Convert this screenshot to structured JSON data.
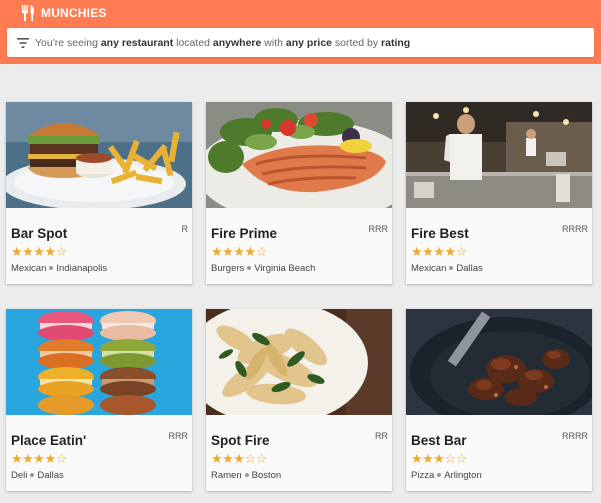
{
  "app": {
    "title": "MUNCHIES",
    "icon": "fork-knife-icon",
    "accent": "#ff7c53"
  },
  "filter": {
    "icon": "filter-icon",
    "prefix": "You're seeing ",
    "restaurant_filter": "any restaurant",
    "location_prefix": " located ",
    "location_filter": "anywhere",
    "price_prefix": " with ",
    "price_filter": "any price",
    "sort_prefix": " sorted by ",
    "sort_filter": "rating"
  },
  "restaurants": [
    {
      "name": "Bar Spot",
      "price": "R",
      "rating": 4,
      "stars": "★★★★☆",
      "category": "Mexican",
      "city": "Indianapolis",
      "image": "burger-fries-photo"
    },
    {
      "name": "Fire Prime",
      "price": "RRR",
      "rating": 4,
      "stars": "★★★★☆",
      "category": "Burgers",
      "city": "Virginia Beach",
      "image": "salmon-salad-photo"
    },
    {
      "name": "Fire Best",
      "price": "RRRR",
      "rating": 4,
      "stars": "★★★★☆",
      "category": "Mexican",
      "city": "Dallas",
      "image": "restaurant-kitchen-photo"
    },
    {
      "name": "Place Eatin'",
      "price": "RRR",
      "rating": 4,
      "stars": "★★★★☆",
      "category": "Deli",
      "city": "Dallas",
      "image": "macarons-photo"
    },
    {
      "name": "Spot Fire",
      "price": "RR",
      "rating": 3,
      "stars": "★★★☆☆",
      "category": "Ramen",
      "city": "Boston",
      "image": "pasta-plate-photo"
    },
    {
      "name": "Best Bar",
      "price": "RRRR",
      "rating": 3,
      "stars": "★★★☆☆",
      "category": "Pizza",
      "city": "Arlington",
      "image": "braised-meat-photo"
    }
  ]
}
